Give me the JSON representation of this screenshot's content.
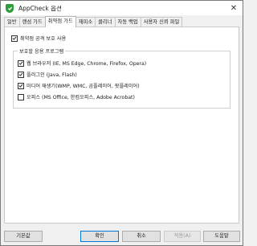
{
  "window": {
    "title": "AppCheck 옵션",
    "close_glyph": "✕"
  },
  "tabs": [
    {
      "label": "일반",
      "active": false
    },
    {
      "label": "랜섬 가드",
      "active": false
    },
    {
      "label": "취약점 가드",
      "active": true
    },
    {
      "label": "재피소",
      "active": false
    },
    {
      "label": "클리너",
      "active": false
    },
    {
      "label": "자동 백업",
      "active": false
    },
    {
      "label": "사용자 신뢰 파일",
      "active": false
    }
  ],
  "exploit_guard": {
    "enable_label": "취약점 공격 보호 사용",
    "enable_checked": true,
    "group_title": "보호할 응용 프로그램",
    "apps": [
      {
        "label": "웹 브라우저 (IE, MS Edge, Chrome, Firefox, Opera)",
        "checked": true
      },
      {
        "label": "플러그인 (Java, Flash)",
        "checked": true
      },
      {
        "label": "미디어 재생기(WMP, WMC, 곰플레이어, 팟플레이어)",
        "checked": true
      },
      {
        "label": "오피스 (MS Office, 한컴오피스, Adobe Acrobat)",
        "checked": false
      }
    ]
  },
  "buttons": {
    "defaults": "기본값",
    "ok": "확인",
    "cancel": "취소",
    "apply": "적용(A)",
    "help": "도움말"
  },
  "colors": {
    "app_icon": "#2e9c3a",
    "default_button_border": "#0078d7"
  }
}
